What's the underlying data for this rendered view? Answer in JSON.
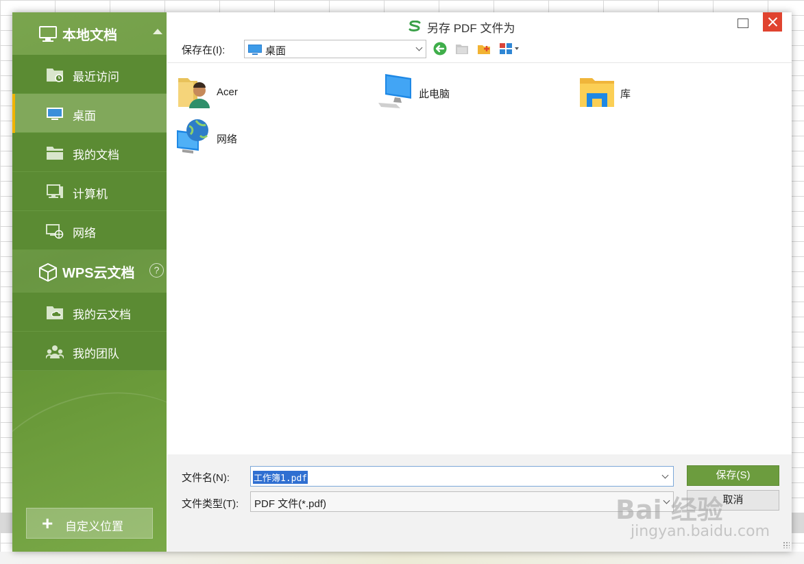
{
  "dialog": {
    "title": "另存 PDF 文件为",
    "colors": {
      "accent": "#6c9c3e",
      "sidebar": "#5b8b33",
      "active_marker": "#f0b400",
      "close": "#e0432f"
    }
  },
  "sidebar": {
    "local_section": {
      "label": "本地文档",
      "icon": "monitor-icon"
    },
    "local_items": [
      {
        "label": "最近访问",
        "icon": "recent-folder-icon"
      },
      {
        "label": "桌面",
        "icon": "desktop-icon",
        "active": true
      },
      {
        "label": "我的文档",
        "icon": "documents-folder-icon"
      },
      {
        "label": "计算机",
        "icon": "computer-icon"
      },
      {
        "label": "网络",
        "icon": "network-icon"
      }
    ],
    "cloud_section": {
      "label": "WPS云文档",
      "icon": "cube-icon",
      "help": "?"
    },
    "cloud_items": [
      {
        "label": "我的云文档",
        "icon": "cloud-folder-icon"
      },
      {
        "label": "我的团队",
        "icon": "team-icon"
      }
    ],
    "custom_location": {
      "plus": "+",
      "label": "自定义位置"
    }
  },
  "toolbar": {
    "save_in_label": "保存在(I):",
    "location": "桌面"
  },
  "files": [
    {
      "name": "Acer",
      "icon": "user-folder-icon"
    },
    {
      "name": "此电脑",
      "icon": "this-pc-icon"
    },
    {
      "name": "库",
      "icon": "library-icon"
    },
    {
      "name": "网络",
      "icon": "network-globe-icon"
    }
  ],
  "bottom": {
    "filename_label": "文件名(N):",
    "filename_value": "工作簿1.pdf",
    "filetype_label": "文件类型(T):",
    "filetype_value": "PDF 文件(*.pdf)",
    "save_button": "保存(S)",
    "cancel_button": "取消"
  },
  "watermark": {
    "line1": "Bai 经验",
    "line2": "jingyan.baidu.com"
  }
}
